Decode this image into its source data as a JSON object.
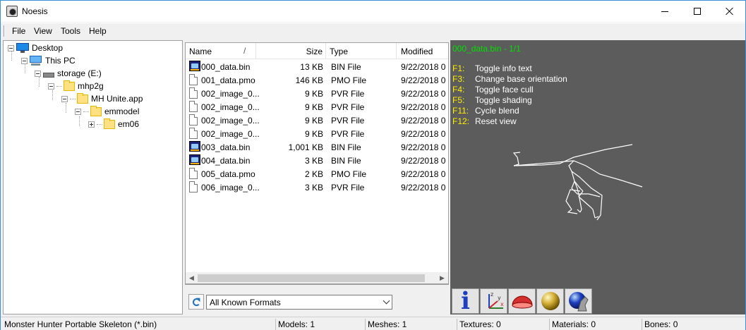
{
  "window": {
    "title": "Noesis"
  },
  "menu": [
    "File",
    "View",
    "Tools",
    "Help"
  ],
  "tree": [
    {
      "label": "Desktop",
      "icon": "desktop-monitor-icon"
    },
    {
      "label": "This PC",
      "icon": "computer-icon"
    },
    {
      "label": "storage (E:)",
      "icon": "drive-icon"
    },
    {
      "label": "mhp2g",
      "icon": "folder-icon"
    },
    {
      "label": "MH Unite.app",
      "icon": "folder-icon"
    },
    {
      "label": "emmodel",
      "icon": "folder-icon"
    },
    {
      "label": "em06",
      "icon": "folder-icon"
    }
  ],
  "filelist": {
    "columns": {
      "name": "Name",
      "size": "Size",
      "type": "Type",
      "modified": "Modified"
    },
    "sort_indicator": "/",
    "rows": [
      {
        "name": "000_data.bin",
        "size": "13 KB",
        "type": "BIN File",
        "modified": "9/22/2018 0",
        "icon": "noesis-model-icon"
      },
      {
        "name": "001_data.pmo",
        "size": "146 KB",
        "type": "PMO File",
        "modified": "9/22/2018 0",
        "icon": "document-icon"
      },
      {
        "name": "002_image_0...",
        "size": "9 KB",
        "type": "PVR File",
        "modified": "9/22/2018 0",
        "icon": "document-icon"
      },
      {
        "name": "002_image_0...",
        "size": "9 KB",
        "type": "PVR File",
        "modified": "9/22/2018 0",
        "icon": "document-icon"
      },
      {
        "name": "002_image_0...",
        "size": "9 KB",
        "type": "PVR File",
        "modified": "9/22/2018 0",
        "icon": "document-icon"
      },
      {
        "name": "002_image_0...",
        "size": "9 KB",
        "type": "PVR File",
        "modified": "9/22/2018 0",
        "icon": "document-icon"
      },
      {
        "name": "003_data.bin",
        "size": "1,001 KB",
        "type": "BIN File",
        "modified": "9/22/2018 0",
        "icon": "noesis-model-icon"
      },
      {
        "name": "004_data.bin",
        "size": "3 KB",
        "type": "BIN File",
        "modified": "9/22/2018 0",
        "icon": "noesis-model-icon"
      },
      {
        "name": "005_data.pmo",
        "size": "2 KB",
        "type": "PMO File",
        "modified": "9/22/2018 0",
        "icon": "document-icon"
      },
      {
        "name": "006_image_0...",
        "size": "3 KB",
        "type": "PVR File",
        "modified": "9/22/2018 0",
        "icon": "document-icon"
      }
    ]
  },
  "format_filter": {
    "selected": "All Known Formats"
  },
  "viewport": {
    "title": "000_data.bin - 1/1",
    "help": [
      {
        "key": "F1:",
        "action": "Toggle info text"
      },
      {
        "key": "F3:",
        "action": "Change base orientation"
      },
      {
        "key": "F4:",
        "action": "Toggle face cull"
      },
      {
        "key": "F5:",
        "action": "Toggle shading"
      },
      {
        "key": "F11:",
        "action": "Cycle blend"
      },
      {
        "key": "F12:",
        "action": "Reset view"
      }
    ],
    "colors": {
      "background": "#5c5c5c",
      "title": "#00e000",
      "key": "#ffee00",
      "text": "#ffffff"
    }
  },
  "toolbar": [
    {
      "name": "info-button",
      "icon": "info-icon",
      "glyph": "i"
    },
    {
      "name": "axes-button",
      "icon": "axes-icon",
      "axis_labels": [
        "z",
        "y",
        "x"
      ]
    },
    {
      "name": "dome-button",
      "icon": "red-dome-icon"
    },
    {
      "name": "sphere-button",
      "icon": "gold-sphere-icon"
    },
    {
      "name": "animation-button",
      "icon": "animation-icon"
    }
  ],
  "status": {
    "format": "Monster Hunter Portable Skeleton (*.bin)",
    "models": "Models: 1",
    "meshes": "Meshes: 1",
    "textures": "Textures: 0",
    "materials": "Materials: 0",
    "bones": "Bones: 0"
  }
}
